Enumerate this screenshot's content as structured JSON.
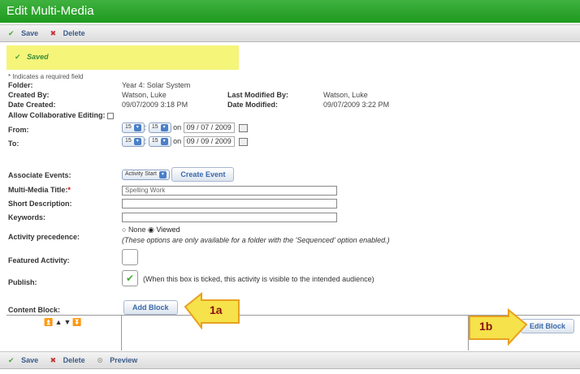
{
  "window": {
    "title": "Edit Multi-Media"
  },
  "toolbar": {
    "save": "Save",
    "delete": "Delete",
    "preview": "Preview"
  },
  "status": {
    "saved": "Saved"
  },
  "note": "* Indicates a required field",
  "form": {
    "folder_label": "Folder:",
    "folder_value": "Year 4: Solar System",
    "created_by_label": "Created By:",
    "created_by_value": "Watson, Luke",
    "last_modified_by_label": "Last Modified By:",
    "last_modified_by_value": "Watson, Luke",
    "date_created_label": "Date Created:",
    "date_created_value": "09/07/2009 3:18 PM",
    "date_modified_label": "Date Modified:",
    "date_modified_value": "09/07/2009 3:22 PM",
    "collab_label": "Allow Collaborative Editing:",
    "from_label": "From:",
    "from_hour": "15",
    "from_min": "15",
    "from_on": "on",
    "from_day": "09",
    "from_month": "07",
    "from_year": "2009",
    "to_label": "To:",
    "to_hour": "15",
    "to_min": "15",
    "to_on": "on",
    "to_day": "09",
    "to_month": "09",
    "to_year": "2009",
    "assoc_label": "Associate Events:",
    "assoc_select": "Activity Start",
    "create_event": "Create Event",
    "title_label": "Multi-Media Title:",
    "title_req": "*",
    "title_value": "Spelling Work",
    "short_desc_label": "Short Description:",
    "keywords_label": "Keywords:",
    "precedence_label": "Activity precedence:",
    "precedence_none": "None",
    "precedence_viewed": "Viewed",
    "precedence_note": "(These options are only available for a folder with the 'Sequenced' option enabled.)",
    "featured_label": "Featured Activity:",
    "publish_label": "Publish:",
    "publish_note": "(When this box is ticked, this activity is visible to the intended audience)",
    "content_label": "Content Block:",
    "add_block": "Add Block",
    "edit_block": "Edit Block",
    "order_arrows": "⏫▲▼⏬"
  },
  "callouts": {
    "a": "1a",
    "b": "1b"
  },
  "colors": {
    "title_green": "#1f9a1f",
    "callout_fill": "#f6e24a",
    "callout_border": "#e8a020"
  }
}
